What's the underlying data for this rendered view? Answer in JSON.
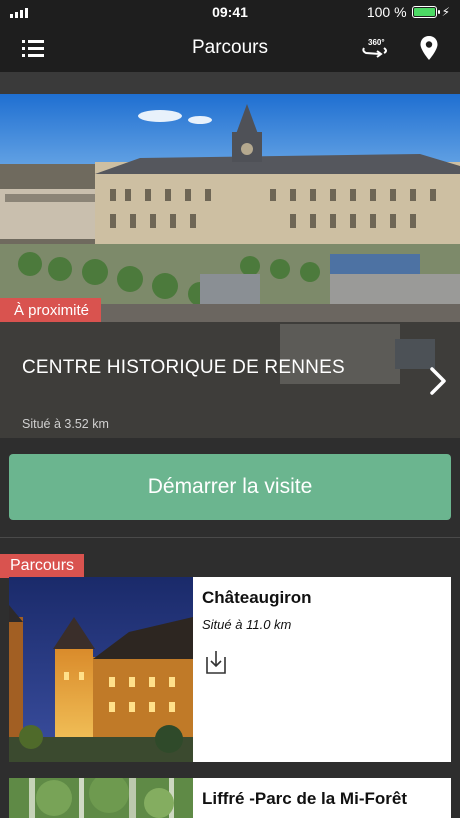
{
  "status_bar": {
    "time": "09:41",
    "battery_text": "100 %",
    "icons": [
      "signal-icon",
      "battery-icon",
      "charging-bolt-icon"
    ],
    "battery_color": "#4cd964"
  },
  "nav": {
    "title": "Parcours",
    "left_icon": "menu-list-icon",
    "right_icons": [
      "360-view-icon",
      "location-pin-icon"
    ],
    "label_360": "360°"
  },
  "hero": {
    "tag": "À proximité",
    "title": "CENTRE HISTORIQUE DE RENNES",
    "distance": "Situé à 3.52 km",
    "icon": "chevron-right-icon"
  },
  "start_button": {
    "label": "Démarrer la visite"
  },
  "section": {
    "tag": "Parcours"
  },
  "cards": [
    {
      "title": "Châteaugiron",
      "distance": "Situé à 11.0 km",
      "icon": "download-icon"
    },
    {
      "title": "Liffré -Parc de la Mi-Forêt"
    }
  ],
  "colors": {
    "accent_red": "#d9534f",
    "start_green": "#6bb58f",
    "nav_bg": "#1e1e1e",
    "page_bg": "#2e2e2e"
  }
}
